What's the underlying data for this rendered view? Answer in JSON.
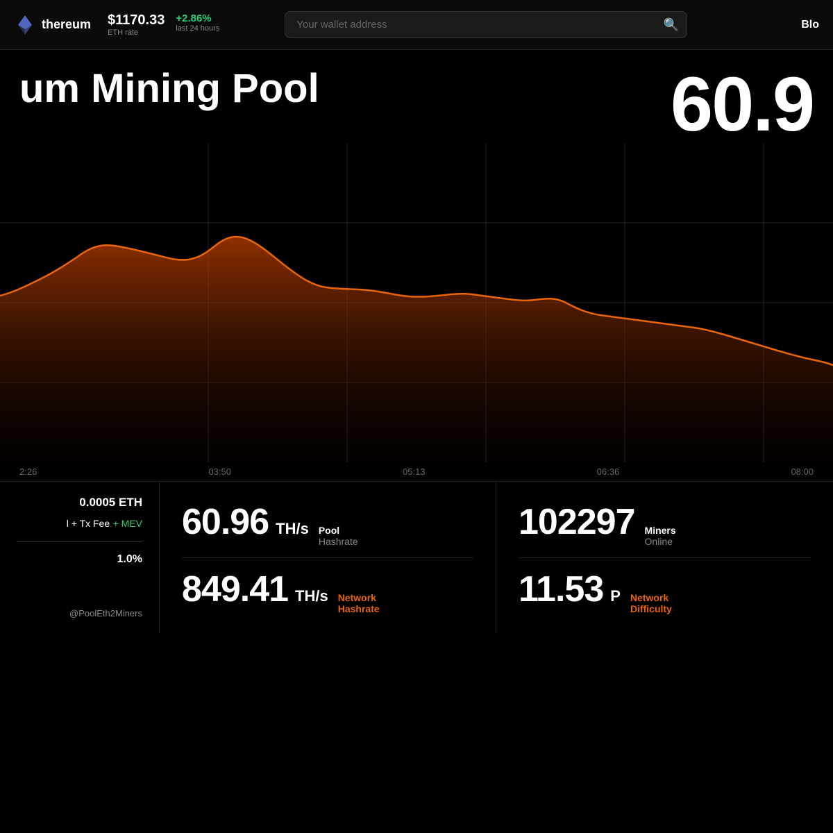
{
  "header": {
    "brand": "thereum",
    "price": "$1170.33",
    "change": "+2.86%",
    "eth_rate_label": "ETH rate",
    "change_label": "last 24 hours",
    "wallet_placeholder": "Your wallet address",
    "nav_right": "Blo"
  },
  "hero": {
    "title": "um Mining Pool",
    "hashrate_display": "60.9"
  },
  "chart": {
    "time_labels": [
      "2:26",
      "03:50",
      "05:13",
      "06:36",
      "08:00"
    ]
  },
  "stats": {
    "left": {
      "min_payout": "0.0005 ETH",
      "reward_type": "l + Tx Fee",
      "mev_label": "+ MEV",
      "fee": "1.0%",
      "contact": "@PoolEth2Miners"
    },
    "pool_hashrate_value": "60.96",
    "pool_hashrate_unit": "TH/s",
    "pool_hashrate_label_top": "Pool",
    "pool_hashrate_label_bot": "Hashrate",
    "miners_value": "102297",
    "miners_label_top": "Miners",
    "miners_label_bot": "Online",
    "network_hashrate_value": "849.41",
    "network_hashrate_unit": "TH/s",
    "network_hashrate_label_top": "Network",
    "network_hashrate_label_bot": "Hashrate",
    "network_diff_value": "11.53",
    "network_diff_unit": "P",
    "network_diff_label_top": "Network",
    "network_diff_label_bot": "Difficulty"
  }
}
